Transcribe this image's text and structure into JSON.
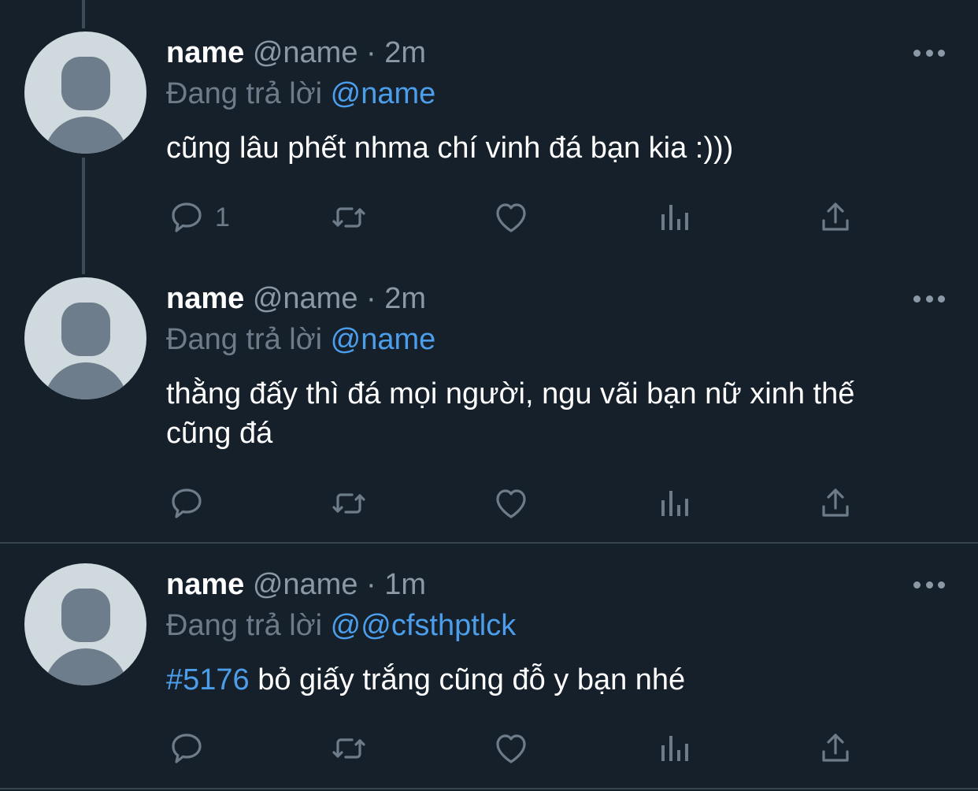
{
  "tweets": [
    {
      "name": "name",
      "handle": "@name",
      "separator": "·",
      "time": "2m",
      "reply_prefix": "Đang trả lời",
      "reply_to": "@name",
      "hashtag": "",
      "text": "cũng lâu phết nhma chí vinh đá bạn kia :)))",
      "reply_count": "1"
    },
    {
      "name": "name",
      "handle": "@name",
      "separator": "·",
      "time": "2m",
      "reply_prefix": "Đang trả lời",
      "reply_to": "@name",
      "hashtag": "",
      "text": "thằng đấy thì đá mọi người, ngu vãi bạn nữ xinh thế cũng đá",
      "reply_count": ""
    },
    {
      "name": "name",
      "handle": "@name",
      "separator": "·",
      "time": "1m",
      "reply_prefix": "Đang trả lời",
      "reply_to": "@@cfsthptlck",
      "hashtag": "#5176",
      "text": " bỏ giấy trắng cũng đỗ y bạn nhé",
      "reply_count": ""
    }
  ],
  "icons": {
    "reply": "reply-icon",
    "retweet": "retweet-icon",
    "like": "heart-icon",
    "views": "analytics-icon",
    "share": "share-icon",
    "more": "more-icon"
  },
  "colors": {
    "background": "#15202b",
    "link": "#4c9eeb",
    "secondary_text": "#8b98a5",
    "icon": "#6e7c89"
  }
}
